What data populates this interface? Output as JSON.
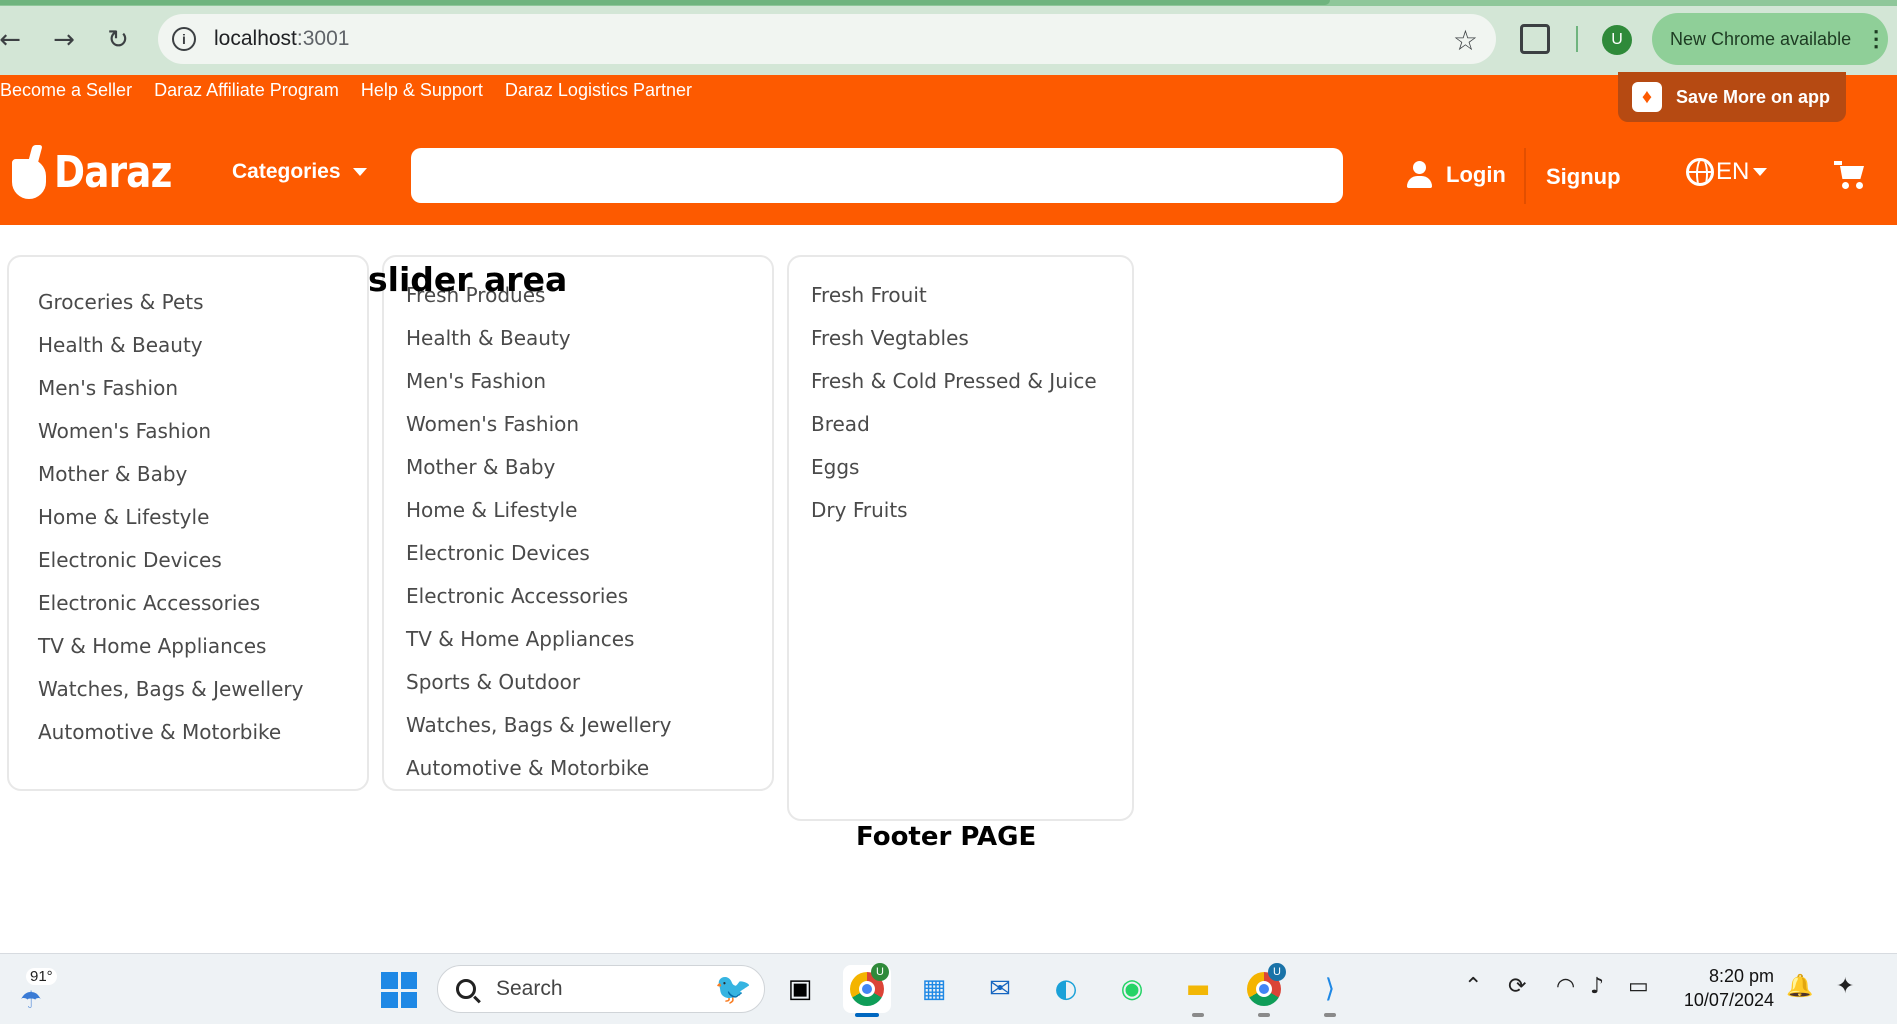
{
  "browser": {
    "url_host": "localhost",
    "url_port": ":3001",
    "update_label": "New Chrome available",
    "profile_initial": "U"
  },
  "top_links": [
    "Become a Seller",
    "Daraz Affiliate Program",
    "Help & Support",
    "Daraz Logistics Partner"
  ],
  "save_app_label": "Save More on app",
  "header": {
    "logo_text": "Daraz",
    "categories_label": "Categories",
    "search_value": "",
    "login_label": "Login",
    "signup_label": "Signup",
    "language_label": "EN",
    "brand_color": "#fd5a00"
  },
  "menu_level1": [
    "Groceries & Pets",
    "Health & Beauty",
    "Men's Fashion",
    "Women's Fashion",
    "Mother & Baby",
    "Home & Lifestyle",
    "Electronic Devices",
    "Electronic Accessories",
    "TV & Home Appliances",
    "Watches, Bags & Jewellery",
    "Automotive & Motorbike"
  ],
  "menu_level2": [
    "Fresh Produes",
    "Health & Beauty",
    "Men's Fashion",
    "Women's Fashion",
    "Mother & Baby",
    "Home & Lifestyle",
    "Electronic Devices",
    "Electronic Accessories",
    "TV & Home Appliances",
    "Sports & Outdoor",
    "Watches, Bags & Jewellery",
    "Automotive & Motorbike"
  ],
  "menu_level3": [
    "Fresh Frouit",
    "Fresh Vegtables",
    "Fresh & Cold Pressed & Juice",
    "Bread",
    "Eggs",
    "Dry Fruits"
  ],
  "slider_label": "slider area",
  "footer_label": "Footer PAGE",
  "taskbar": {
    "temperature": "91°",
    "search_label": "Search",
    "time": "8:20 pm",
    "date": "10/07/2024",
    "chrome_badge_1": "U",
    "chrome_badge_2": "U"
  }
}
